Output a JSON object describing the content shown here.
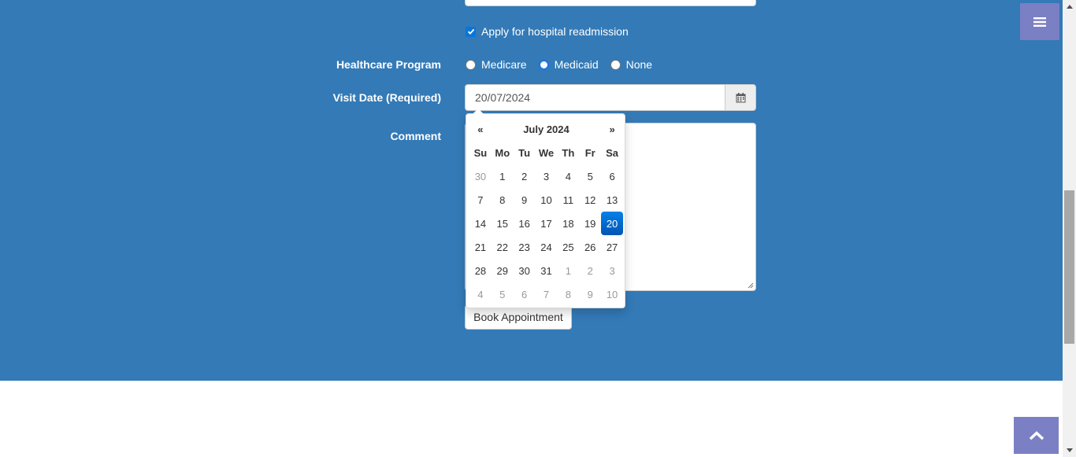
{
  "form": {
    "readmission_label": "Apply for hospital readmission",
    "readmission_checked": true,
    "healthcare_program_label": "Healthcare Program",
    "programs": [
      "Medicare",
      "Medicaid",
      "None"
    ],
    "visit_date_label": "Visit Date (Required)",
    "visit_date_value": "20/07/2024",
    "comment_label": "Comment",
    "book_button": "Book Appointment"
  },
  "datepicker": {
    "prev": "«",
    "next": "»",
    "month_title": "July 2024",
    "weekdays": [
      "Su",
      "Mo",
      "Tu",
      "We",
      "Th",
      "Fr",
      "Sa"
    ],
    "weeks": [
      [
        "30",
        "1",
        "2",
        "3",
        "4",
        "5",
        "6"
      ],
      [
        "7",
        "8",
        "9",
        "10",
        "11",
        "12",
        "13"
      ],
      [
        "14",
        "15",
        "16",
        "17",
        "18",
        "19",
        "20"
      ],
      [
        "21",
        "22",
        "23",
        "24",
        "25",
        "26",
        "27"
      ],
      [
        "28",
        "29",
        "30",
        "31",
        "1",
        "2",
        "3"
      ],
      [
        "4",
        "5",
        "6",
        "7",
        "8",
        "9",
        "10"
      ]
    ],
    "selected_day": "20"
  },
  "icons": {
    "menu": "hamburger-icon",
    "calendar": "calendar-icon",
    "back_to_top": "chevron-up-icon"
  },
  "colors": {
    "section_bg": "#337ab7",
    "floating_button": "#7b7fc4",
    "selected_day": "#0a6fd6"
  }
}
